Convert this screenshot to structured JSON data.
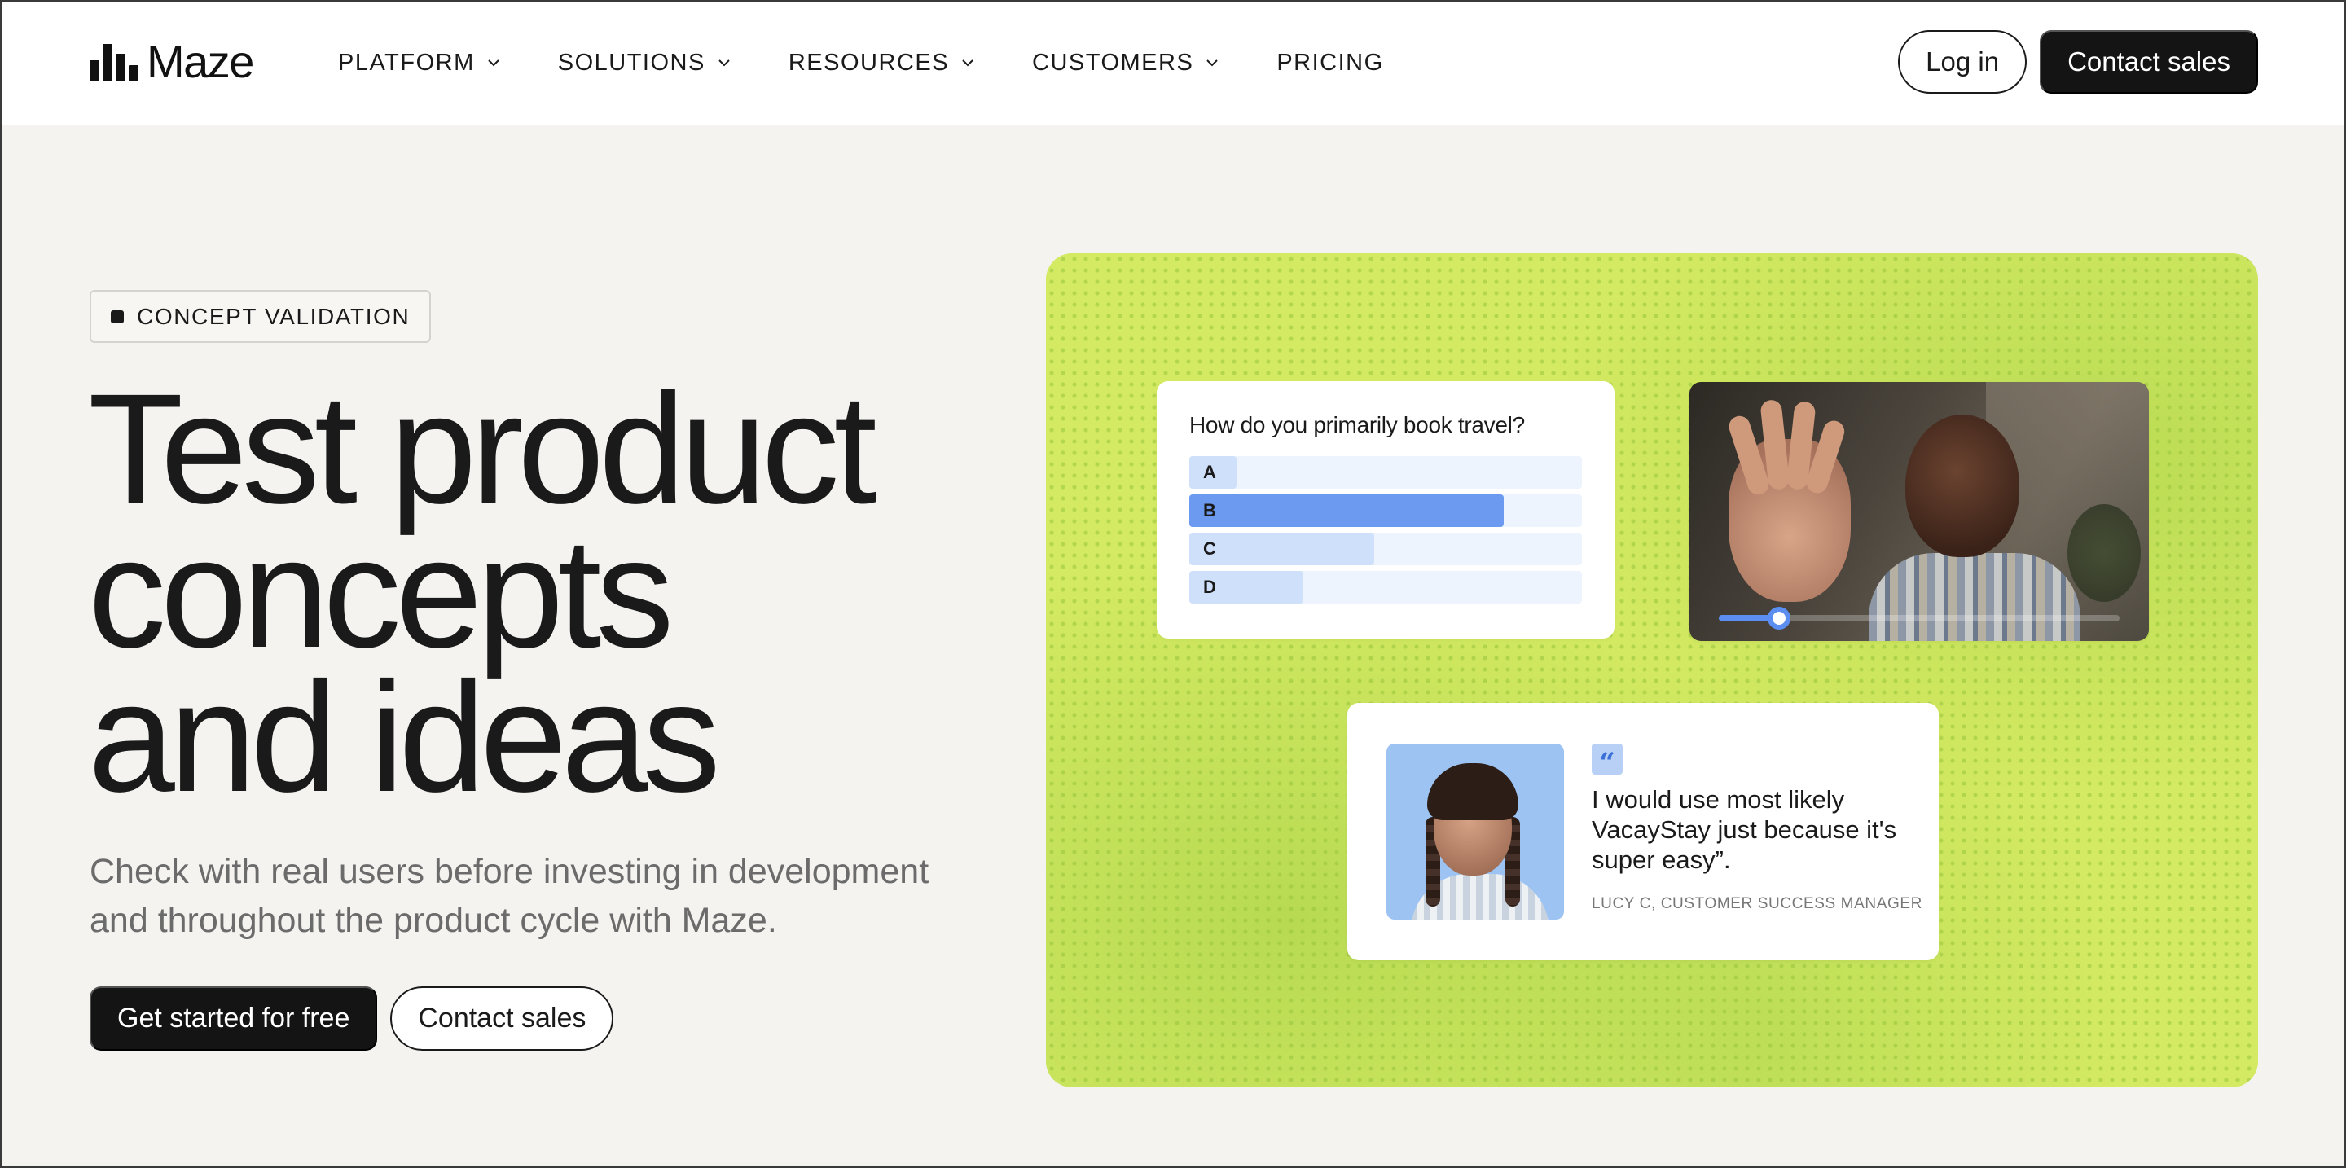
{
  "brand": {
    "name": "Maze"
  },
  "nav": {
    "items": [
      {
        "label": "PLATFORM",
        "has_dropdown": true
      },
      {
        "label": "SOLUTIONS",
        "has_dropdown": true
      },
      {
        "label": "RESOURCES",
        "has_dropdown": true
      },
      {
        "label": "CUSTOMERS",
        "has_dropdown": true
      },
      {
        "label": "PRICING",
        "has_dropdown": false
      }
    ],
    "login_label": "Log in",
    "contact_label": "Contact sales"
  },
  "hero": {
    "tag": "CONCEPT VALIDATION",
    "headline": [
      "Test product",
      "concepts",
      "and ideas"
    ],
    "subtitle": "Check with real users before investing in development and throughout the product cycle with Maze.",
    "primary_cta": "Get started for free",
    "secondary_cta": "Contact sales"
  },
  "visual": {
    "background_color": "#d4ea62",
    "poll": {
      "question": "How do you primarily book travel?",
      "options": [
        {
          "label": "A",
          "fraction": 0.12,
          "selected": false
        },
        {
          "label": "B",
          "fraction": 0.8,
          "selected": true
        },
        {
          "label": "C",
          "fraction": 0.47,
          "selected": false
        },
        {
          "label": "D",
          "fraction": 0.29,
          "selected": false
        }
      ],
      "selected_color": "#6b9af0",
      "bar_color": "#cfe0fb"
    },
    "video": {
      "progress": 0.15,
      "accent": "#5b8ef0"
    },
    "quote": {
      "mark": "“",
      "text": "I would use most likely VacayStay just because it's super easy”.",
      "author": "LUCY C, CUSTOMER SUCCESS MANAGER"
    }
  }
}
